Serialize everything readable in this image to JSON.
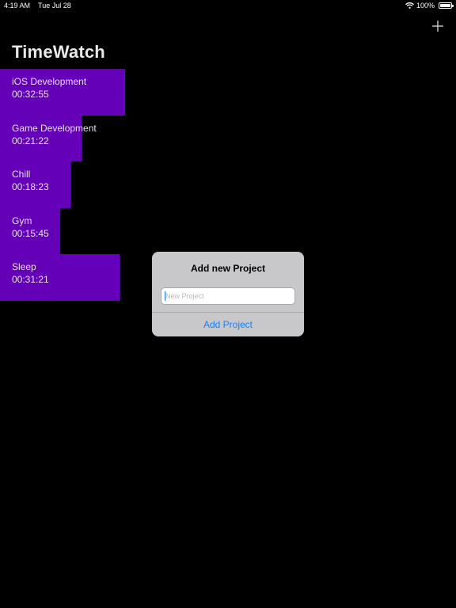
{
  "status_bar": {
    "time": "4:19 AM",
    "date": "Tue Jul 28",
    "battery": "100%",
    "battery_level": 1.0
  },
  "header": {
    "title": "TimeWatch",
    "add_icon": "plus-icon"
  },
  "projects": [
    {
      "name": "iOS Development",
      "time": "00:32:55"
    },
    {
      "name": "Game Development",
      "time": "00:21:22"
    },
    {
      "name": "Chill",
      "time": "00:18:23"
    },
    {
      "name": "Gym",
      "time": "00:15:45"
    },
    {
      "name": "Sleep",
      "time": "00:31:21"
    }
  ],
  "alert": {
    "title": "Add new Project",
    "input_placeholder": "New Project",
    "input_value": "",
    "action_label": "Add Project"
  },
  "colors": {
    "background": "#000000",
    "project_bar": "#6400b8",
    "alert_background": "#c8c8ca",
    "accent": "#1a7ef5"
  }
}
